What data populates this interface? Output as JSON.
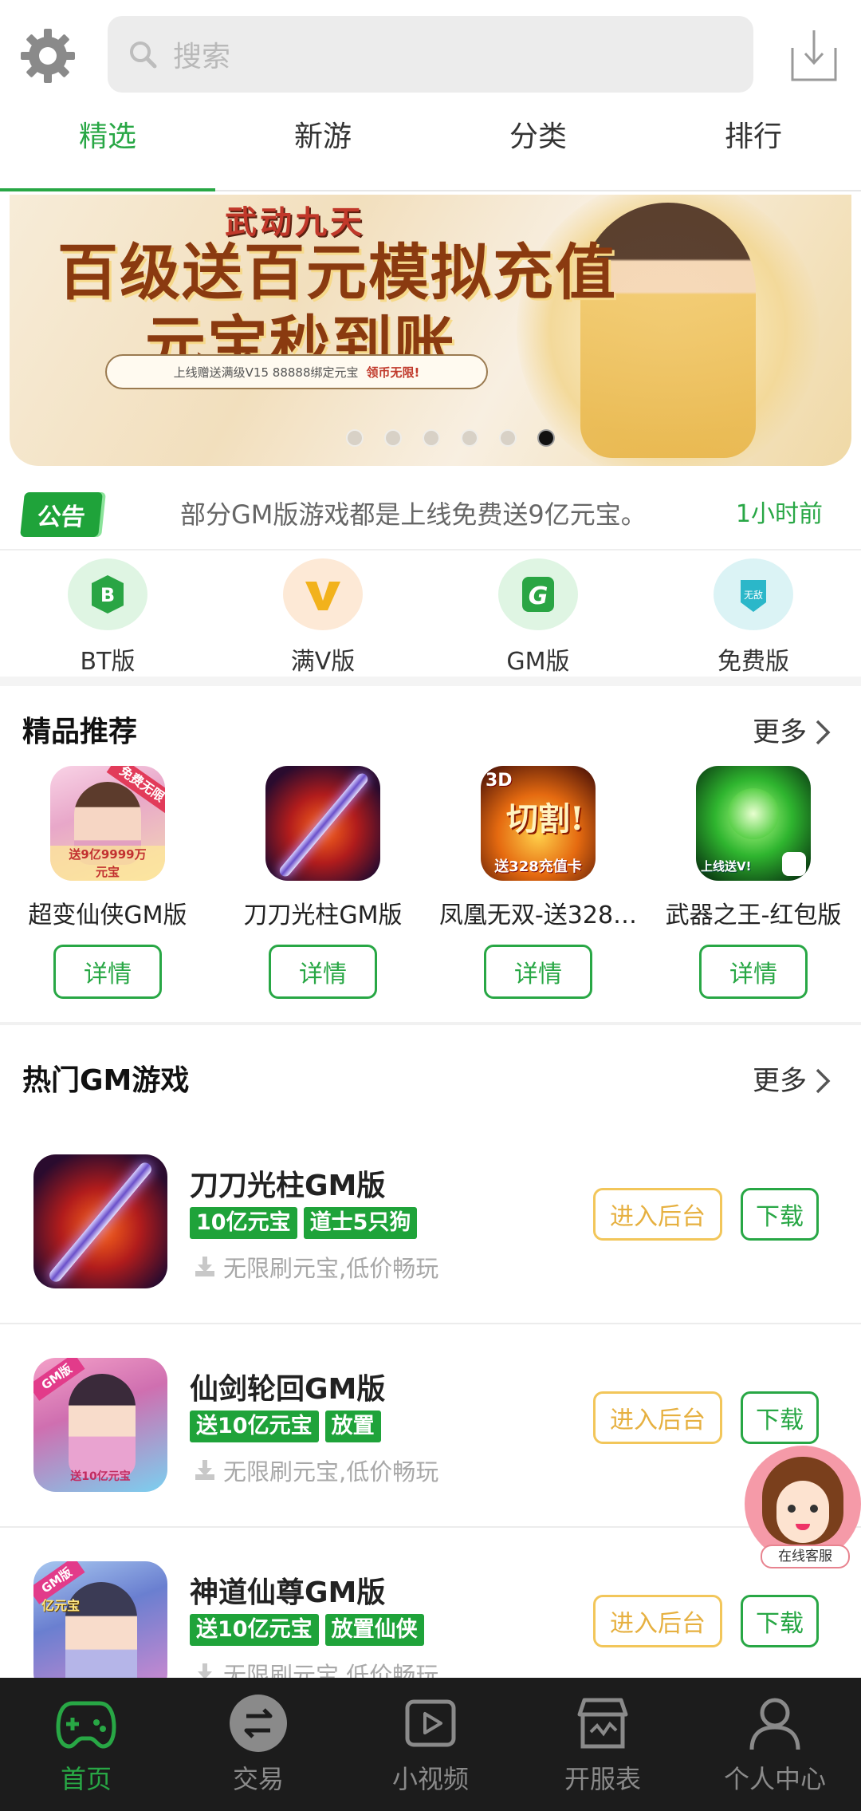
{
  "search": {
    "placeholder": "搜索"
  },
  "tabs": [
    {
      "label": "精选",
      "active": true
    },
    {
      "label": "新游"
    },
    {
      "label": "分类"
    },
    {
      "label": "排行"
    }
  ],
  "banner": {
    "game_logo": "武动九天",
    "headline_1": "百级送百元模拟充值",
    "headline_2": "元宝秒到账",
    "sub_text": "上线赠送满级V15  88888绑定元宝",
    "sub_highlight": "领币无限!",
    "slide_count": 6,
    "active_slide": 6
  },
  "notice": {
    "badge": "公告",
    "text": "部分GM版游戏都是上线免费送9亿元宝。",
    "time": "1小时前"
  },
  "categories": [
    {
      "label": "BT版",
      "icon": "bt-icon"
    },
    {
      "label": "满V版",
      "icon": "v-icon"
    },
    {
      "label": "GM版",
      "icon": "gm-icon"
    },
    {
      "label": "免费版",
      "icon": "free-icon"
    }
  ],
  "featured": {
    "title": "精品推荐",
    "more": "更多",
    "items": [
      {
        "name": "超变仙侠GM版",
        "button": "详情",
        "icon_text": "免费无限 送9亿9999万元宝"
      },
      {
        "name": "刀刀光柱GM版",
        "button": "详情"
      },
      {
        "name": "凤凰无双-送328…",
        "button": "详情",
        "icon_text": "3D 切割! 送328充值卡"
      },
      {
        "name": "武器之王-红包版",
        "button": "详情",
        "icon_text": "上线送V!"
      }
    ]
  },
  "hot": {
    "title": "热门GM游戏",
    "more": "更多",
    "items": [
      {
        "name": "刀刀光柱GM版",
        "tags": [
          "10亿元宝",
          "道士5只狗"
        ],
        "desc": "无限刷元宝,低价畅玩",
        "admin": "进入后台",
        "download": "下载"
      },
      {
        "name": "仙剑轮回GM版",
        "tags": [
          "送10亿元宝",
          "放置"
        ],
        "desc": "无限刷元宝,低价畅玩",
        "admin": "进入后台",
        "download": "下载",
        "icon_text": "GM版 送10亿元宝"
      },
      {
        "name": "神道仙尊GM版",
        "tags": [
          "送10亿元宝",
          "放置仙侠"
        ],
        "desc": "无限刷元宝,低价畅玩",
        "admin": "进入后台",
        "download": "下载",
        "icon_text": "GM版 亿元宝"
      }
    ]
  },
  "service": {
    "label": "在线客服"
  },
  "bottom_nav": [
    {
      "label": "首页",
      "icon": "gamepad-icon",
      "active": true
    },
    {
      "label": "交易",
      "icon": "exchange-icon"
    },
    {
      "label": "小视频",
      "icon": "video-icon"
    },
    {
      "label": "开服表",
      "icon": "store-icon"
    },
    {
      "label": "个人中心",
      "icon": "user-icon"
    }
  ],
  "colors": {
    "accent": "#28a745",
    "tag_green": "#1fa33a",
    "admin_yellow": "#f2c65a",
    "nav_bg": "#1c1c1c"
  }
}
